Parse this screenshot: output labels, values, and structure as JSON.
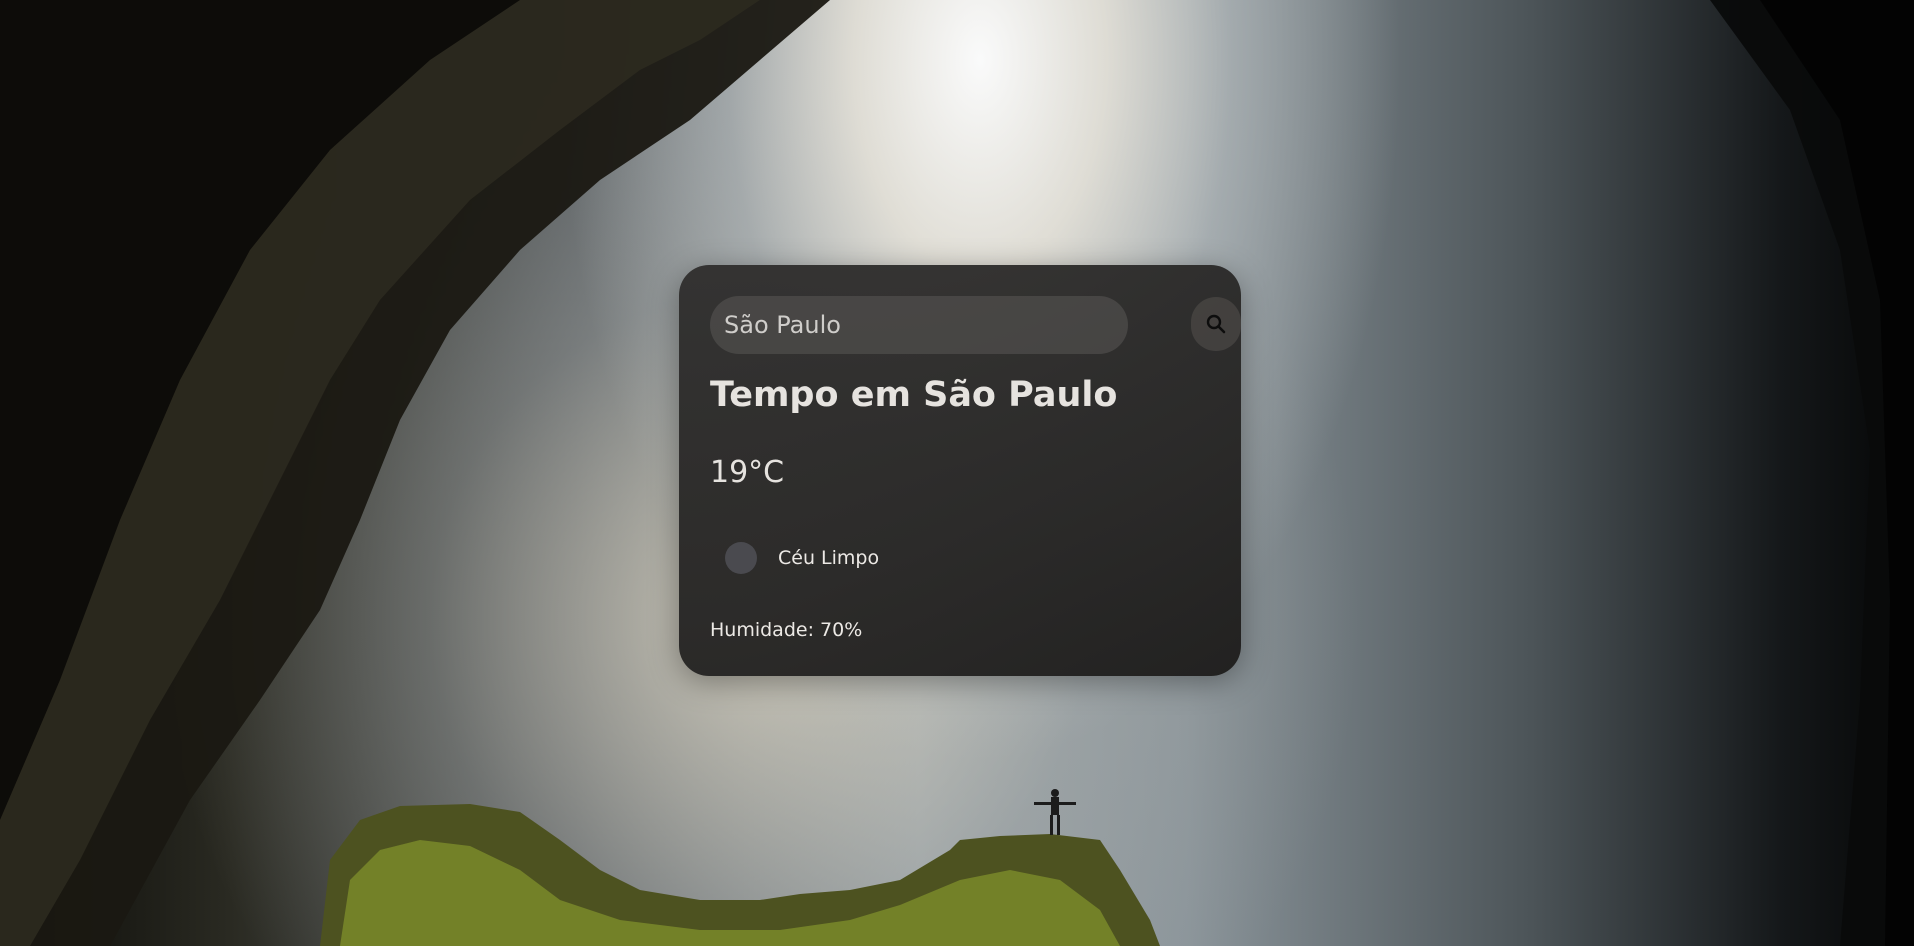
{
  "search": {
    "value": "São Paulo",
    "placeholder": "São Paulo"
  },
  "weather": {
    "title": "Tempo em São Paulo",
    "temperature": "19°C",
    "condition": "Céu Limpo",
    "condition_icon": "weather-icon",
    "humidity": "Humidade: 70%"
  },
  "icons": {
    "search_button": "search-icon"
  },
  "colors": {
    "card_background": "#2b2a29",
    "input_background": "#4a4846",
    "text": "#e6e3df"
  }
}
